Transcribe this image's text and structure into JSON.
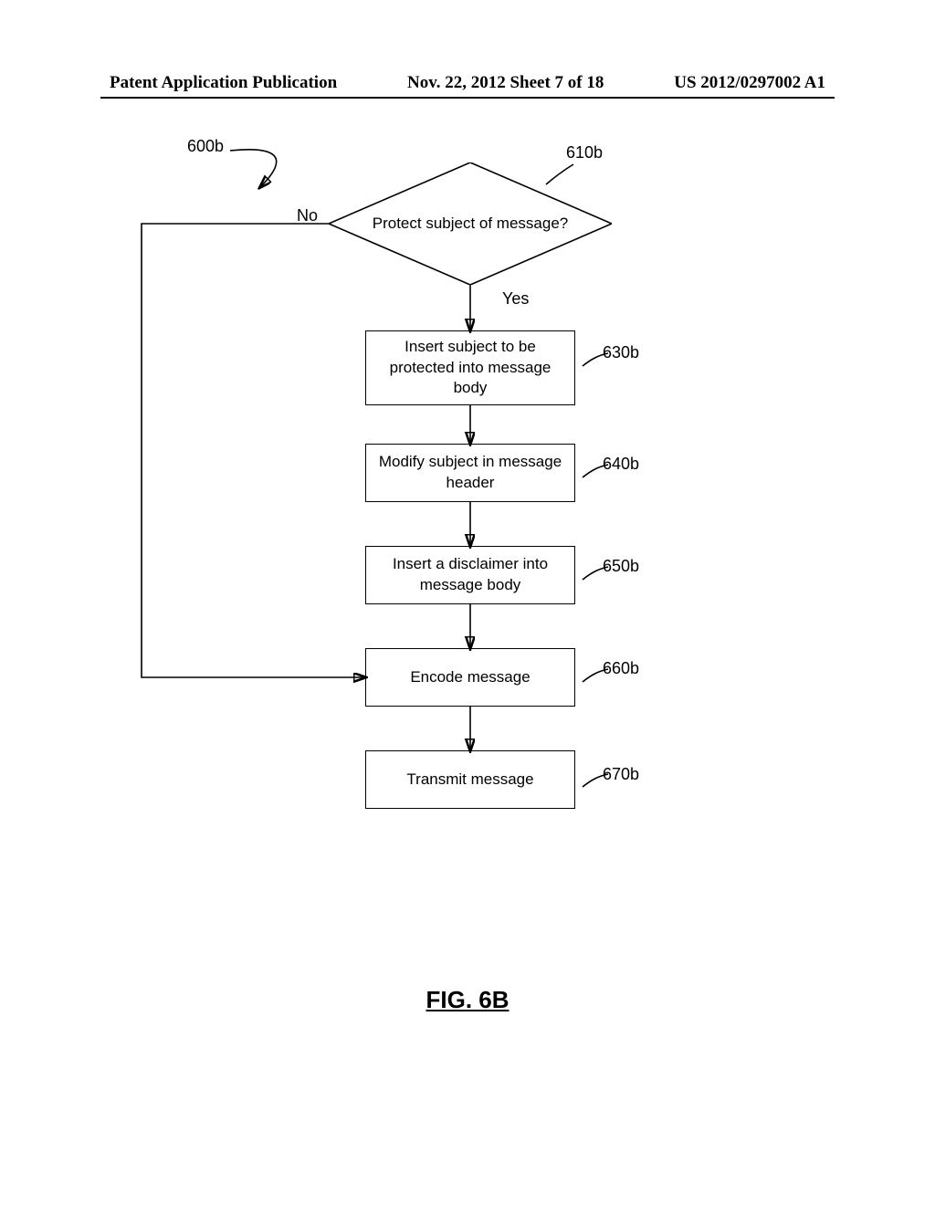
{
  "header": {
    "left": "Patent Application Publication",
    "center": "Nov. 22, 2012  Sheet 7 of 18",
    "right": "US 2012/0297002 A1"
  },
  "figure_label": "FIG. 6B",
  "chart_data": {
    "type": "flowchart",
    "start_ref": "600b",
    "nodes": [
      {
        "id": "610b",
        "shape": "decision",
        "text": "Protect subject of message?"
      },
      {
        "id": "630b",
        "shape": "process",
        "text": "Insert subject to be protected into message body"
      },
      {
        "id": "640b",
        "shape": "process",
        "text": "Modify subject in message header"
      },
      {
        "id": "650b",
        "shape": "process",
        "text": "Insert a disclaimer into message body"
      },
      {
        "id": "660b",
        "shape": "process",
        "text": "Encode message"
      },
      {
        "id": "670b",
        "shape": "process",
        "text": "Transmit message"
      }
    ],
    "edges": [
      {
        "from": "start",
        "to": "610b"
      },
      {
        "from": "610b",
        "to": "630b",
        "label": "Yes"
      },
      {
        "from": "610b",
        "to": "660b",
        "label": "No"
      },
      {
        "from": "630b",
        "to": "640b"
      },
      {
        "from": "640b",
        "to": "650b"
      },
      {
        "from": "650b",
        "to": "660b"
      },
      {
        "from": "660b",
        "to": "670b"
      }
    ],
    "edge_labels": {
      "yes": "Yes",
      "no": "No"
    },
    "refs": {
      "600b": "600b",
      "610b": "610b",
      "630b": "630b",
      "640b": "640b",
      "650b": "650b",
      "660b": "660b",
      "670b": "670b"
    }
  }
}
